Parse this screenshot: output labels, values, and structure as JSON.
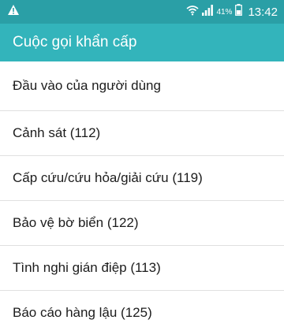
{
  "status_bar": {
    "battery_percent": "41%",
    "time": "13:42",
    "icons": [
      "warning-icon",
      "wifi-icon",
      "signal-icon",
      "battery-icon"
    ]
  },
  "app_bar": {
    "title": "Cuộc gọi khẩn cấp"
  },
  "colors": {
    "status_bar": "#2a9fa6",
    "app_bar": "#33b4bb",
    "divider": "#e0e0e0",
    "text": "#1c1c1c"
  },
  "list": {
    "items": [
      {
        "label": "Đầu vào của người dùng"
      },
      {
        "label": "Cảnh sát (112)"
      },
      {
        "label": "Cấp cứu/cứu hỏa/giải cứu (119)"
      },
      {
        "label": "Bảo vệ bờ biển (122)"
      },
      {
        "label": "Tình nghi gián điệp (113)"
      },
      {
        "label": "Báo cáo hàng lậu (125)"
      }
    ]
  }
}
